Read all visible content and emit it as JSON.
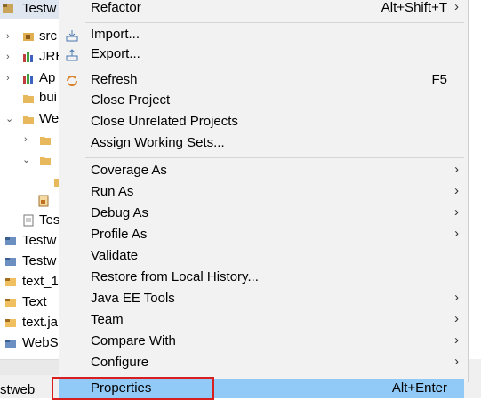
{
  "explorer": {
    "rows": [
      {
        "label": "Testw",
        "icon": "project-icon",
        "twisty": ""
      },
      {
        "label": "src",
        "icon": "package-folder-icon",
        "twisty": "›"
      },
      {
        "label": "JRE",
        "icon": "library-icon",
        "twisty": "›"
      },
      {
        "label": "Ap",
        "icon": "library-icon",
        "twisty": "›"
      },
      {
        "label": "bui",
        "icon": "folder-icon",
        "twisty": ""
      },
      {
        "label": "We",
        "icon": "folder-icon",
        "twisty": "⌄"
      },
      {
        "label": "",
        "icon": "folder-icon",
        "twisty": "›"
      },
      {
        "label": "",
        "icon": "folder-icon",
        "twisty": "⌄"
      },
      {
        "label": "",
        "icon": "folder-icon",
        "twisty": ""
      },
      {
        "label": "",
        "icon": "file-icon",
        "twisty": ""
      },
      {
        "label": "Tes",
        "icon": "file-icon",
        "twisty": ""
      },
      {
        "label": "Testw",
        "icon": "project-icon",
        "twisty": ""
      },
      {
        "label": "Testw",
        "icon": "project-icon",
        "twisty": ""
      },
      {
        "label": "text_1",
        "icon": "project-icon",
        "twisty": ""
      },
      {
        "label": "Text_",
        "icon": "project-icon",
        "twisty": ""
      },
      {
        "label": "text.ja",
        "icon": "project-icon",
        "twisty": ""
      },
      {
        "label": "WebS",
        "icon": "project-icon",
        "twisty": ""
      }
    ]
  },
  "status": {
    "text": "stweb"
  },
  "menu": {
    "items": [
      {
        "label": "Refactor",
        "shortcut": "Alt+Shift+T",
        "submenu": true
      },
      {
        "label": "Import...",
        "icon": "import-icon"
      },
      {
        "label": "Export...",
        "icon": "export-icon"
      },
      {
        "label": "Refresh",
        "shortcut": "F5",
        "icon": "refresh-icon"
      },
      {
        "label": "Close Project"
      },
      {
        "label": "Close Unrelated Projects"
      },
      {
        "label": "Assign Working Sets..."
      },
      {
        "label": "Coverage As",
        "submenu": true
      },
      {
        "label": "Run As",
        "submenu": true
      },
      {
        "label": "Debug As",
        "submenu": true
      },
      {
        "label": "Profile As",
        "submenu": true
      },
      {
        "label": "Validate"
      },
      {
        "label": "Restore from Local History..."
      },
      {
        "label": "Java EE Tools",
        "submenu": true
      },
      {
        "label": "Team",
        "submenu": true
      },
      {
        "label": "Compare With",
        "submenu": true
      },
      {
        "label": "Configure",
        "submenu": true
      }
    ],
    "properties": {
      "label": "Properties",
      "shortcut": "Alt+Enter"
    }
  },
  "colors": {
    "menu_bg": "#f2f2f2",
    "selected_bg": "#91c9f7",
    "highlight_border": "#d81e1e"
  }
}
